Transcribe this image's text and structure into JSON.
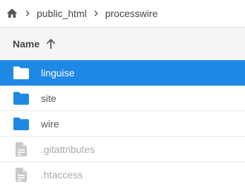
{
  "breadcrumb": {
    "home_icon": "home-icon",
    "items": [
      "public_html",
      "processwire"
    ]
  },
  "header": {
    "name_label": "Name",
    "sort_icon": "arrow-up-icon"
  },
  "files": [
    {
      "name": "linguise",
      "type": "folder",
      "selected": true
    },
    {
      "name": "site",
      "type": "folder",
      "selected": false
    },
    {
      "name": "wire",
      "type": "folder",
      "selected": false
    },
    {
      "name": ".gitattributes",
      "type": "file",
      "selected": false
    },
    {
      "name": ".htaccess",
      "type": "file",
      "selected": false
    }
  ],
  "colors": {
    "accent": "#1e88e5",
    "folder": "#1e88e5",
    "folder_selected": "#ffffff",
    "file_icon": "#c9c9c9"
  }
}
